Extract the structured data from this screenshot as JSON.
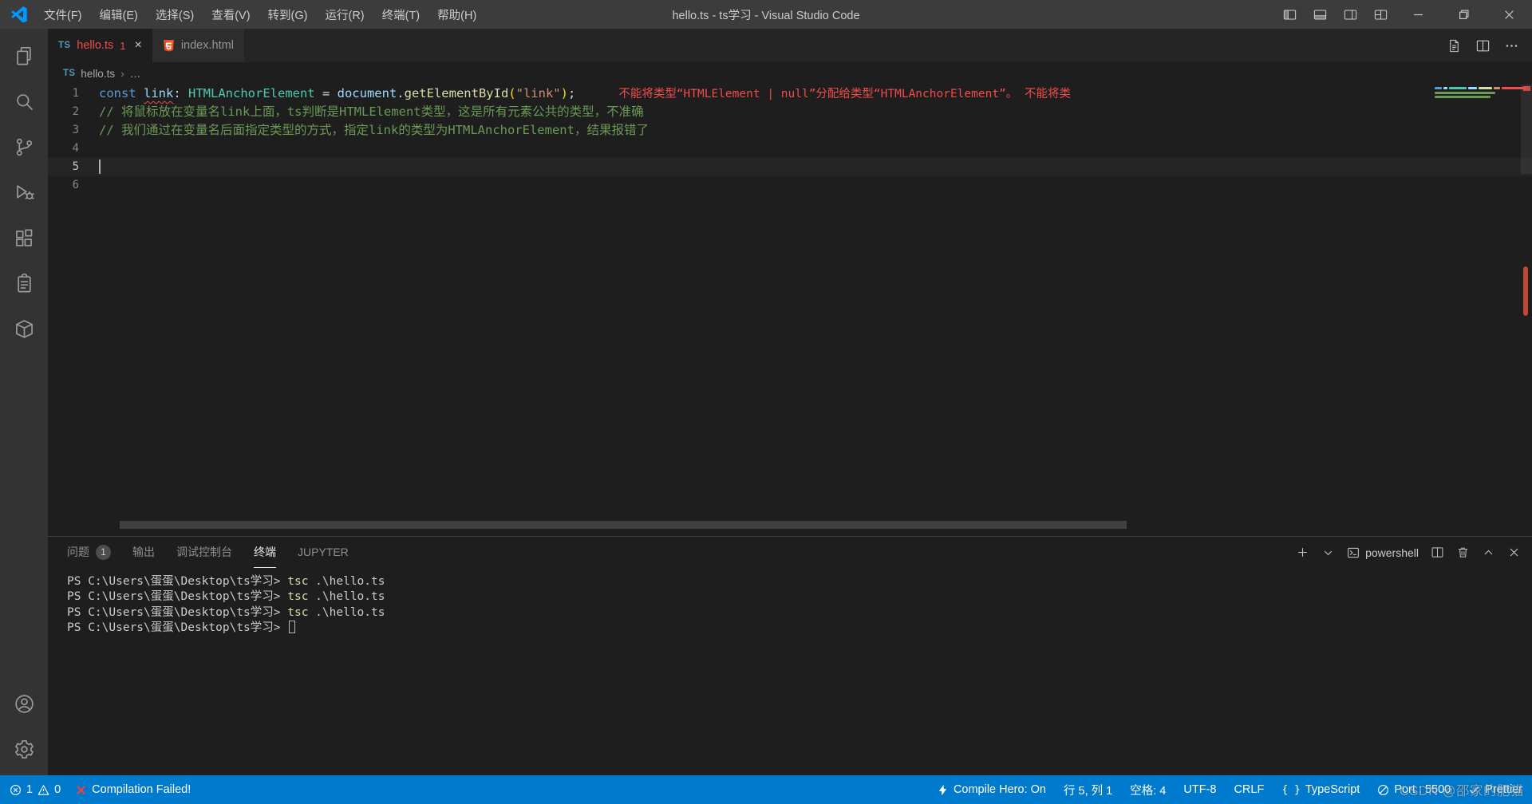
{
  "window": {
    "title": "hello.ts - ts学习 - Visual Studio Code",
    "menus": [
      "文件(F)",
      "编辑(E)",
      "选择(S)",
      "查看(V)",
      "转到(G)",
      "运行(R)",
      "终端(T)",
      "帮助(H)"
    ]
  },
  "tabs": {
    "active": {
      "icon": "TS",
      "label": "hello.ts",
      "error_count": "1",
      "close": "×"
    },
    "inactive": {
      "label": "index.html"
    }
  },
  "breadcrumb": {
    "icon": "TS",
    "file": "hello.ts",
    "separator": "›",
    "ellipsis": "…"
  },
  "editor": {
    "lines": [
      {
        "num": "1",
        "tokens": [
          {
            "text": "const ",
            "cls": "tk-kw"
          },
          {
            "text": "link",
            "cls": "tk-var squiggle"
          },
          {
            "text": ": ",
            "cls": "tk-punc"
          },
          {
            "text": "HTMLAnchorElement",
            "cls": "tk-type"
          },
          {
            "text": " = ",
            "cls": "tk-punc"
          },
          {
            "text": "document",
            "cls": "tk-var"
          },
          {
            "text": ".",
            "cls": "tk-punc"
          },
          {
            "text": "getElementById",
            "cls": "tk-fn"
          },
          {
            "text": "(",
            "cls": "tk-paren"
          },
          {
            "text": "\"link\"",
            "cls": "tk-str"
          },
          {
            "text": ")",
            "cls": "tk-paren"
          },
          {
            "text": ";",
            "cls": "tk-punc"
          },
          {
            "text": "不能将类型“HTMLElement | null”分配给类型“HTMLAnchorElement”。 不能将类",
            "cls": "tk-error-lens"
          }
        ]
      },
      {
        "num": "2",
        "tokens": [
          {
            "text": "// 将鼠标放在变量名link上面，ts判断是HTMLElement类型，这是所有元素公共的类型，不准确",
            "cls": "tk-comment"
          }
        ]
      },
      {
        "num": "3",
        "tokens": [
          {
            "text": "// 我们通过在变量名后面指定类型的方式，指定link的类型为HTMLAnchorElement，结果报错了",
            "cls": "tk-comment"
          }
        ]
      },
      {
        "num": "4",
        "tokens": []
      },
      {
        "num": "5",
        "tokens": [],
        "current": true,
        "cursor": true
      },
      {
        "num": "6",
        "tokens": []
      }
    ]
  },
  "panel": {
    "tabs": [
      {
        "label": "问题",
        "badge": "1"
      },
      {
        "label": "输出"
      },
      {
        "label": "调试控制台"
      },
      {
        "label": "终端",
        "active": true
      },
      {
        "label": "JUPYTER"
      }
    ],
    "terminal": {
      "shell_label": "powershell",
      "lines": [
        {
          "tokens": [
            {
              "text": "PS C:\\Users\\蛋蛋\\Desktop\\ts学习> ",
              "cls": ""
            },
            {
              "text": "tsc",
              "cls": "t-cmd"
            },
            {
              "text": " .\\hello.ts",
              "cls": ""
            }
          ]
        },
        {
          "tokens": [
            {
              "text": "PS C:\\Users\\蛋蛋\\Desktop\\ts学习> ",
              "cls": ""
            },
            {
              "text": "tsc",
              "cls": "t-cmd"
            },
            {
              "text": " .\\hello.ts",
              "cls": ""
            }
          ]
        },
        {
          "tokens": [
            {
              "text": "PS C:\\Users\\蛋蛋\\Desktop\\ts学习> ",
              "cls": ""
            },
            {
              "text": "tsc",
              "cls": "t-cmd"
            },
            {
              "text": " .\\hello.ts",
              "cls": ""
            }
          ]
        },
        {
          "tokens": [
            {
              "text": "PS C:\\Users\\蛋蛋\\Desktop\\ts学习> ",
              "cls": ""
            }
          ],
          "cursor": true
        }
      ]
    }
  },
  "status_bar": {
    "errors": "1",
    "warnings": "0",
    "message": "Compilation Failed!",
    "compile_hero": "Compile Hero: On",
    "cursor_position": "行 5, 列 1",
    "indent": "空格: 4",
    "encoding": "UTF-8",
    "eol": "CRLF",
    "braces": "{ }",
    "language": "TypeScript",
    "port": "Port : 5500",
    "prettier": "Prettier"
  },
  "watermark": "CSDN @邵家的肥猫"
}
